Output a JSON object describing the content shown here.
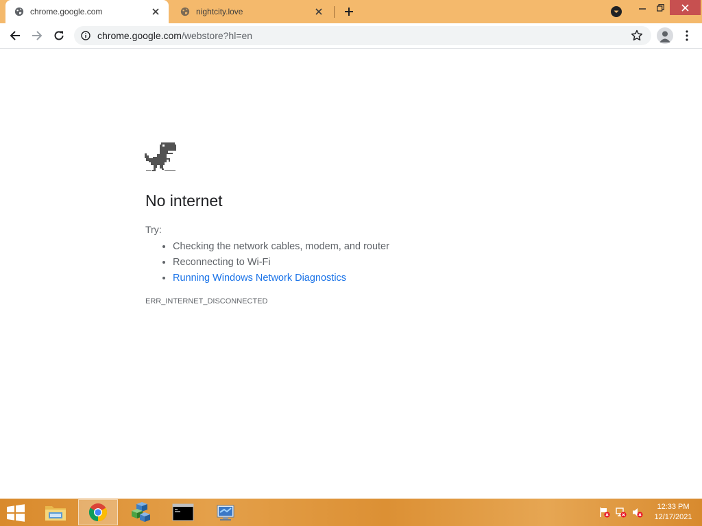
{
  "browser": {
    "tabs": [
      {
        "title": "chrome.google.com",
        "active": true
      },
      {
        "title": "nightcity.love",
        "active": false
      }
    ],
    "address": {
      "host": "chrome.google.com",
      "path": "/webstore?hl=en"
    }
  },
  "error_page": {
    "heading": "No internet",
    "try_label": "Try:",
    "suggestions": [
      "Checking the network cables, modem, and router",
      "Reconnecting to Wi-Fi"
    ],
    "diagnostics_link": "Running Windows Network Diagnostics",
    "error_code": "ERR_INTERNET_DISCONNECTED"
  },
  "taskbar": {
    "apps": [
      "file-explorer",
      "google-chrome",
      "virtualbox",
      "command-prompt",
      "network-connections"
    ],
    "clock": {
      "time": "12:33 PM",
      "date": "12/17/2021"
    }
  },
  "colors": {
    "tabstrip": "#f4b96c",
    "taskbar": "#de9638",
    "link": "#1a73e8",
    "window_close": "#c75050"
  }
}
